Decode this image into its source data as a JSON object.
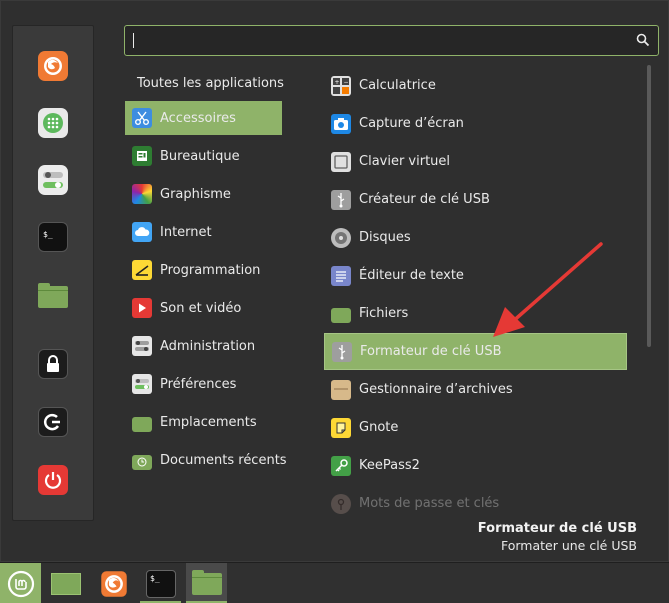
{
  "search": {
    "value": "",
    "placeholder": ""
  },
  "favorites": [
    {
      "icon": "firefox-icon",
      "color": "#e8582a"
    },
    {
      "icon": "software-manager-icon",
      "color": "#6fbf5f"
    },
    {
      "icon": "settings-toggle-icon",
      "color": "#e6e6e6"
    },
    {
      "icon": "terminal-icon",
      "color": "#222222"
    },
    {
      "icon": "folder-icon",
      "color": "#7fa85a"
    },
    {
      "icon": "lock-icon",
      "color": "#222222"
    },
    {
      "icon": "logout-icon",
      "color": "#222222"
    },
    {
      "icon": "power-icon",
      "color": "#e53935"
    }
  ],
  "categories": {
    "header": "Toutes les applications",
    "items": [
      {
        "label": "Accessoires",
        "icon": "scissors-icon",
        "selected": true
      },
      {
        "label": "Bureautique",
        "icon": "office-icon"
      },
      {
        "label": "Graphisme",
        "icon": "graphics-icon"
      },
      {
        "label": "Internet",
        "icon": "cloud-icon"
      },
      {
        "label": "Programmation",
        "icon": "programming-icon"
      },
      {
        "label": "Son et vidéo",
        "icon": "play-icon"
      },
      {
        "label": "Administration",
        "icon": "admin-icon"
      },
      {
        "label": "Préférences",
        "icon": "preferences-icon"
      },
      {
        "label": "Emplacements",
        "icon": "folder-icon"
      },
      {
        "label": "Documents récents",
        "icon": "recent-folder-icon"
      }
    ]
  },
  "apps": [
    {
      "label": "Calculatrice",
      "icon": "calculator-icon"
    },
    {
      "label": "Capture d’écran",
      "icon": "camera-icon"
    },
    {
      "label": "Clavier virtuel",
      "icon": "keyboard-icon"
    },
    {
      "label": "Créateur de clé USB",
      "icon": "usb-icon"
    },
    {
      "label": "Disques",
      "icon": "disk-icon"
    },
    {
      "label": "Éditeur de texte",
      "icon": "text-editor-icon"
    },
    {
      "label": "Fichiers",
      "icon": "folder-icon"
    },
    {
      "label": "Formateur de clé USB",
      "icon": "usb-icon",
      "selected": true
    },
    {
      "label": "Gestionnaire d’archives",
      "icon": "archive-icon"
    },
    {
      "label": "Gnote",
      "icon": "note-icon"
    },
    {
      "label": "KeePass2",
      "icon": "key-icon"
    },
    {
      "label": "Mots de passe et clés",
      "icon": "keyring-icon",
      "faded": true
    }
  ],
  "description": {
    "title": "Formateur de clé USB",
    "text": "Formater une clé USB"
  },
  "taskbar": [
    {
      "icon": "mint-menu-icon"
    },
    {
      "icon": "desktop-icon"
    },
    {
      "icon": "firefox-icon"
    },
    {
      "icon": "terminal-icon"
    },
    {
      "icon": "folder-icon"
    }
  ],
  "colors": {
    "accent": "#8fb369",
    "arrow": "#e53935"
  }
}
